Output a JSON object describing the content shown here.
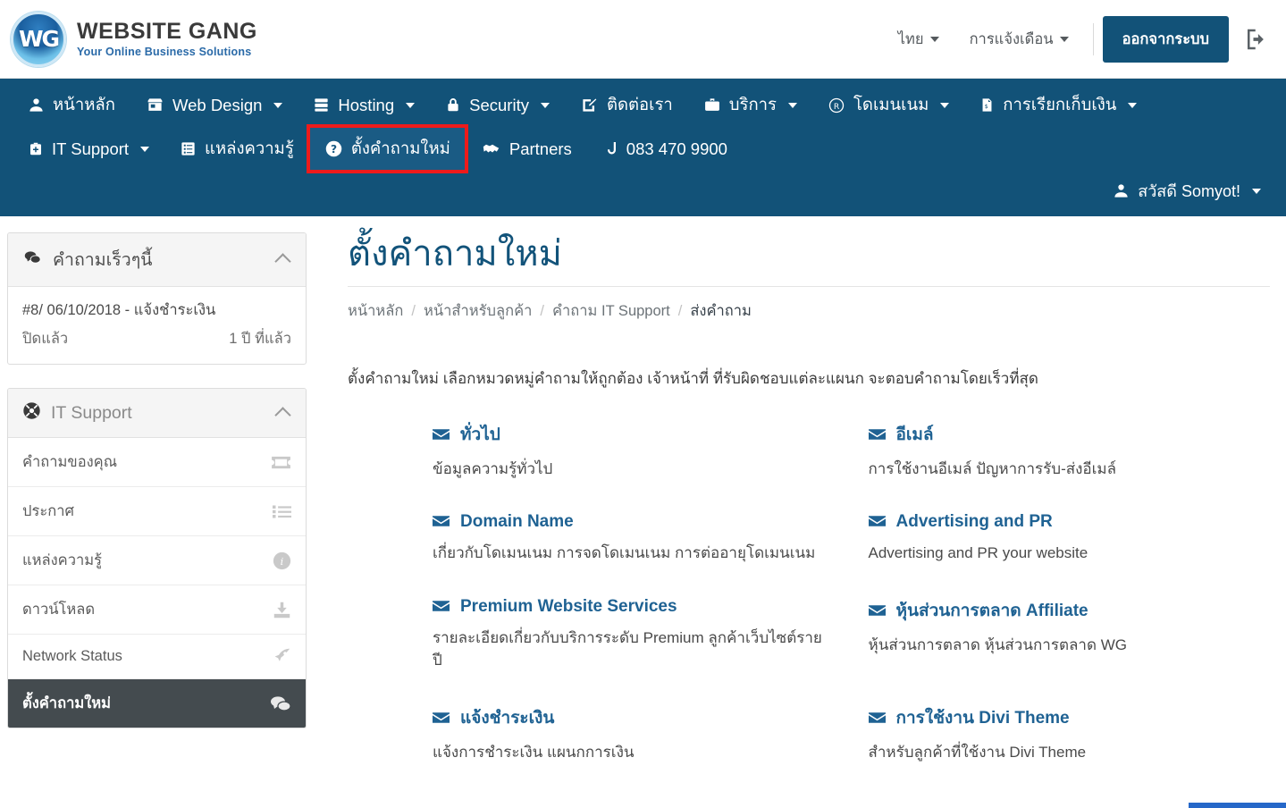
{
  "brand": {
    "logo_text": "WG",
    "title": "WEBSITE GANG",
    "tagline": "Your Online Business Solutions",
    "logo_icon": "wg-circle-logo"
  },
  "header": {
    "language": "ไทย",
    "notifications": "การแจ้งเดือน",
    "logout_label": "ออกจากระบบ",
    "logout_icon": "sign-out-icon",
    "accent_color": "#125278"
  },
  "nav": {
    "row1": [
      {
        "label": "หน้าหลัก",
        "icon": "user-icon",
        "caret": false,
        "highlighted": false
      },
      {
        "label": "Web Design",
        "icon": "store-icon",
        "caret": true,
        "highlighted": false
      },
      {
        "label": "Hosting",
        "icon": "server-icon",
        "caret": true,
        "highlighted": false
      },
      {
        "label": "Security",
        "icon": "lock-icon",
        "caret": true,
        "highlighted": false
      },
      {
        "label": "ติดต่อเรา",
        "icon": "edit-note-icon",
        "caret": false,
        "highlighted": false
      },
      {
        "label": "บริการ",
        "icon": "briefcase-icon",
        "caret": true,
        "highlighted": false
      },
      {
        "label": "โดเมนเนม",
        "icon": "registered-icon",
        "caret": true,
        "highlighted": false
      },
      {
        "label": "การเรียกเก็บเงิน",
        "icon": "invoice-icon",
        "caret": true,
        "highlighted": false
      }
    ],
    "row2": [
      {
        "label": "IT Support",
        "icon": "support-bag-icon",
        "caret": true,
        "highlighted": false
      },
      {
        "label": "แหล่งความรู้",
        "icon": "book-icon",
        "caret": false,
        "highlighted": false
      },
      {
        "label": "ตั้งคำถามใหม่",
        "icon": "question-circle-icon",
        "caret": false,
        "highlighted": true
      },
      {
        "label": "Partners",
        "icon": "handshake-icon",
        "caret": false,
        "highlighted": false
      },
      {
        "label": "083 470 9900",
        "icon": "phone-icon",
        "caret": false,
        "highlighted": false
      }
    ],
    "user_greeting": "สวัสดี Somyot!",
    "user_icon": "user-icon",
    "highlight_color": "#ee1b1b"
  },
  "sidebar": {
    "recent_panel": {
      "title": "คำถามเร็วๆนี้",
      "icon": "comments-icon",
      "collapse_icon": "chevron-up-icon",
      "ticket": {
        "title": "#8/ 06/10/2018 - แจ้งชำระเงิน",
        "status": "ปิดแล้ว",
        "age": "1 ปี ที่แล้ว"
      }
    },
    "support_panel": {
      "title": "IT Support",
      "icon": "lifebuoy-icon",
      "collapse_icon": "chevron-up-icon",
      "items": [
        {
          "label": "คำถามของคุณ",
          "icon": "ticket-icon",
          "active": false
        },
        {
          "label": "ประกาศ",
          "icon": "list-icon",
          "active": false
        },
        {
          "label": "แหล่งความรู้",
          "icon": "info-circle-icon",
          "active": false
        },
        {
          "label": "ดาวน์โหลด",
          "icon": "download-icon",
          "active": false
        },
        {
          "label": "Network Status",
          "icon": "rocket-icon",
          "active": false
        },
        {
          "label": "ตั้งคำถามใหม่",
          "icon": "comments-icon",
          "active": true
        }
      ]
    }
  },
  "main": {
    "title": "ตั้งคำถามใหม่",
    "breadcrumb": [
      {
        "label": "หน้าหลัก",
        "current": false
      },
      {
        "label": "หน้าสำหรับลูกค้า",
        "current": false
      },
      {
        "label": "คำถาม IT Support",
        "current": false
      },
      {
        "label": "ส่งคำถาม",
        "current": true
      }
    ],
    "breadcrumb_separator": "/",
    "intro": "ตั้งคำถามใหม่ เลือกหมวดหมู่คำถามให้ถูกต้อง เจ้าหน้าที่ ที่รับผิดชอบแต่ละแผนก จะตอบคำถามโดยเร็วที่สุด",
    "departments": [
      {
        "name": "ทั่วไป",
        "desc": "ข้อมูลความรู้ทั่วไป",
        "icon": "envelope-icon"
      },
      {
        "name": "อีเมล์",
        "desc": "การใช้งานอีเมล์ ปัญหาการรับ-ส่งอีเมล์",
        "icon": "envelope-icon"
      },
      {
        "name": "Domain Name",
        "desc": "เกี่ยวกับโดเมนเนม การจดโดเมนเนม การต่ออายุโดเมนเนม",
        "icon": "envelope-icon"
      },
      {
        "name": "Advertising and PR",
        "desc": "Advertising and PR your website",
        "icon": "envelope-icon"
      },
      {
        "name": "Premium Website Services",
        "desc": "รายละเอียดเกี่ยวกับบริการระดับ Premium ลูกค้าเว็บไซต์รายปี",
        "icon": "envelope-icon"
      },
      {
        "name": "หุ้นส่วนการตลาด Affiliate",
        "desc": "หุ้นส่วนการตลาด หุ้นส่วนการตลาด WG",
        "icon": "envelope-icon"
      },
      {
        "name": "แจ้งชำระเงิน",
        "desc": "แจ้งการชำระเงิน แผนกการเงิน",
        "icon": "envelope-icon"
      },
      {
        "name": "การใช้งาน Divi Theme",
        "desc": "สำหรับลูกค้าที่ใช้งาน Divi Theme",
        "icon": "envelope-icon"
      }
    ],
    "link_color": "#1f6293"
  }
}
